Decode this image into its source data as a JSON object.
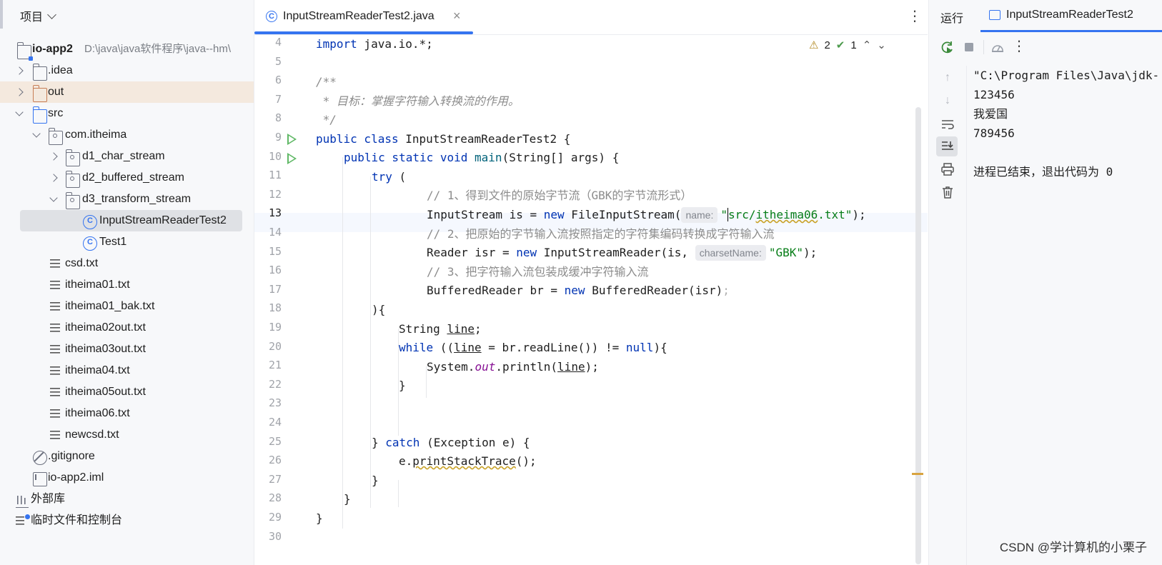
{
  "project_panel": {
    "title": "项目",
    "root": {
      "name": "io-app2",
      "path": "D:\\java\\java软件程序\\java--hm\\"
    },
    "items": [
      {
        "label": "io-app2",
        "extra": "D:\\java\\java软件程序\\java--hm\\"
      },
      {
        "label": ".idea"
      },
      {
        "label": "out"
      },
      {
        "label": "src"
      },
      {
        "label": "com.itheima"
      },
      {
        "label": "d1_char_stream"
      },
      {
        "label": "d2_buffered_stream"
      },
      {
        "label": "d3_transform_stream"
      },
      {
        "label": "InputStreamReaderTest2"
      },
      {
        "label": "Test1"
      },
      {
        "label": "csd.txt"
      },
      {
        "label": "itheima01.txt"
      },
      {
        "label": "itheima01_bak.txt"
      },
      {
        "label": "itheima02out.txt"
      },
      {
        "label": "itheima03out.txt"
      },
      {
        "label": "itheima04.txt"
      },
      {
        "label": "itheima05out.txt"
      },
      {
        "label": "itheima06.txt"
      },
      {
        "label": "newcsd.txt"
      },
      {
        "label": ".gitignore"
      },
      {
        "label": "io-app2.iml"
      },
      {
        "label": "外部库"
      },
      {
        "label": "临时文件和控制台"
      }
    ]
  },
  "editor": {
    "tab_label": "InputStreamReaderTest2.java",
    "inspections": {
      "warnings": "2",
      "ok": "1"
    },
    "line_numbers": [
      "4",
      "5",
      "6",
      "7",
      "8",
      "9",
      "10",
      "11",
      "12",
      "13",
      "14",
      "15",
      "16",
      "17",
      "18",
      "19",
      "20",
      "21",
      "22",
      "23",
      "24",
      "25",
      "26",
      "27",
      "28",
      "29",
      "30"
    ],
    "current_line": "13",
    "code": {
      "l4_kw": "import",
      "l4_rest": " java.io.*;",
      "l6": "/**",
      "l7": " * 目标：掌握字符输入转换流的作用。",
      "l8": " */",
      "l9_kw": "public class",
      "l9_rest": " InputStreamReaderTest2 {",
      "l10_kw": "public static void",
      "l10_fn": "main",
      "l10_rest": "(String[] args) {",
      "l11_kw": "try",
      "l11_rest": " (",
      "l12": "// 1、得到文件的原始字节流（GBK的字节流形式）",
      "l13_a": "InputStream is = ",
      "l13_kw": "new",
      "l13_b": " FileInputStream(",
      "l13_hint": "name:",
      "l13_str_q": "\"",
      "l13_str_a": "src/",
      "l13_str_b": "itheima06",
      "l13_str_c": ".txt\"",
      "l13_end": ");",
      "l14": "// 2、把原始的字节输入流按照指定的字符集编码转换成字符输入流",
      "l15_a": "Reader isr = ",
      "l15_kw": "new",
      "l15_b": " InputStreamReader(is, ",
      "l15_hint": "charsetName:",
      "l15_str": "\"GBK\"",
      "l15_end": ");",
      "l16": "// 3、把字符输入流包装成缓冲字符输入流",
      "l17_a": "BufferedReader br = ",
      "l17_kw": "new",
      "l17_b": " BufferedReader(isr)",
      "l17_semi": ";",
      "l18": "){",
      "l19_a": "String ",
      "l19_var": "line",
      "l19_end": ";",
      "l20_kw": "while",
      "l20_a": " ((",
      "l20_var": "line",
      "l20_b": " = br.readLine()) != ",
      "l20_null": "null",
      "l20_end": "){",
      "l21_a": "System.",
      "l21_out": "out",
      "l21_b": ".println(",
      "l21_var": "line",
      "l21_end": ");",
      "l22": "}",
      "l25_a": "} ",
      "l25_kw": "catch",
      "l25_b": " (Exception e) {",
      "l26_a": "e.",
      "l26_fn": "printStackTrace",
      "l26_b": "();",
      "l27": "}",
      "l28": "}",
      "l29": "}"
    }
  },
  "run_panel": {
    "title": "运行",
    "tab_label": "InputStreamReaderTest2",
    "console": [
      "\"C:\\Program Files\\Java\\jdk-",
      "123456",
      "我爱国",
      "789456",
      "",
      "进程已结束，退出代码为 0"
    ]
  },
  "watermark": "CSDN @学计算机的小栗子",
  "colors": {
    "accent": "#3574f0",
    "keyword": "#0033b3",
    "string": "#067d17",
    "comment": "#8c8c8c",
    "run_green": "#5fb865"
  }
}
